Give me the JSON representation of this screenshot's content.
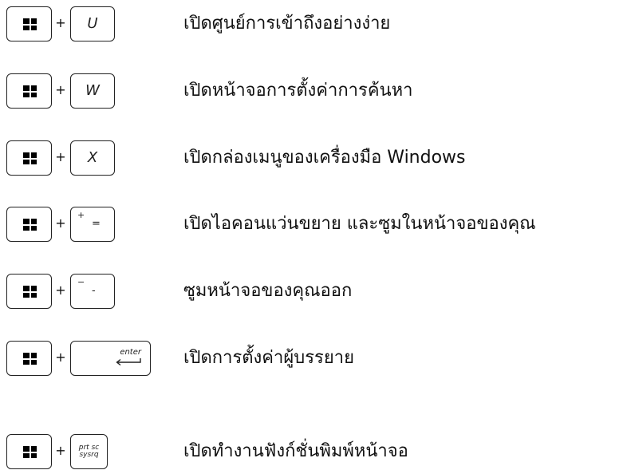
{
  "plus_sign": "+",
  "shortcuts": [
    {
      "key": "U",
      "description": "เปิดศูนย์การเข้าถึงอย่างง่าย"
    },
    {
      "key": "W",
      "description": "เปิดหน้าจอการตั้งค่าการค้นหา"
    },
    {
      "key": "X",
      "description": "เปิดกล่องเมนูของเครื่องมือ Windows"
    },
    {
      "key_top": "+",
      "key_main": "=",
      "description": "เปิดไอคอนแว่นขยาย และซูมในหน้าจอของคุณ"
    },
    {
      "key_top": "−",
      "key_main": "-",
      "description": "ซูมหน้าจอของคุณออก"
    },
    {
      "key": "enter",
      "description": "เปิดการตั้งค่าผู้บรรยาย"
    },
    {
      "key_top": "prt sc",
      "key_bottom": "sysrq",
      "description": "เปิดทำงานฟังก์ชั่นพิมพ์หน้าจอ"
    }
  ],
  "icons": {
    "windows_key": "windows-logo-icon",
    "enter_arrow": "enter-arrow-icon"
  }
}
